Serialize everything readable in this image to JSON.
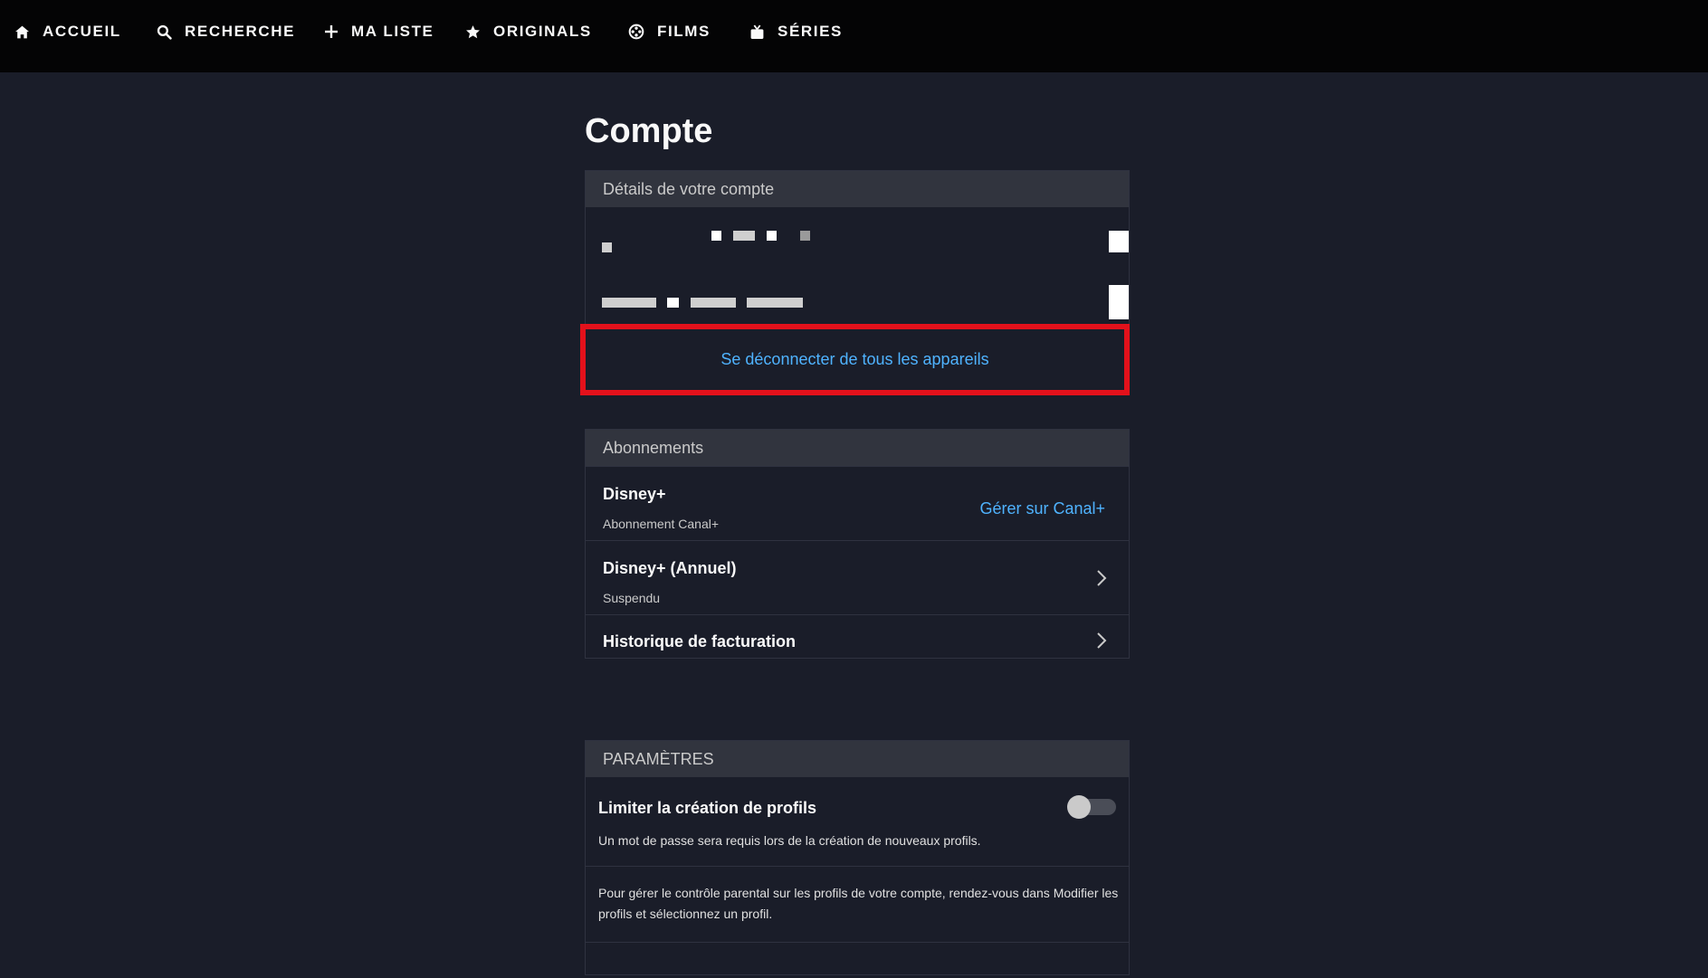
{
  "nav": {
    "items": [
      {
        "label": "ACCUEIL",
        "icon": "home-icon"
      },
      {
        "label": "RECHERCHE",
        "icon": "search-icon"
      },
      {
        "label": "MA LISTE",
        "icon": "plus-icon"
      },
      {
        "label": "ORIGINALS",
        "icon": "star-icon"
      },
      {
        "label": "FILMS",
        "icon": "film-reel-icon"
      },
      {
        "label": "SÉRIES",
        "icon": "tv-icon"
      }
    ]
  },
  "page": {
    "title": "Compte"
  },
  "account": {
    "header": "Détails de votre compte",
    "logout_label": "Se déconnecter de tous les appareils"
  },
  "subscriptions": {
    "header": "Abonnements",
    "items": [
      {
        "title": "Disney+",
        "subtitle": "Abonnement Canal+",
        "action": "Gérer sur Canal+"
      },
      {
        "title": "Disney+ (Annuel)",
        "subtitle": "Suspendu"
      },
      {
        "title": "Historique de facturation"
      }
    ]
  },
  "settings": {
    "header": "PARAMÈTRES",
    "limit_profiles_title": "Limiter la création de profils",
    "limit_profiles_desc": "Un mot de passe sera requis lors de la création de nouveaux profils.",
    "limit_profiles_enabled": false,
    "parental_desc": "Pour gérer le contrôle parental sur les profils de votre compte, rendez-vous dans Modifier les profils et sélectionnez un profil."
  },
  "colors": {
    "background": "#1a1d29",
    "nav_background": "#040405",
    "link": "#4fb3ff",
    "highlight_border": "#e3111b"
  }
}
